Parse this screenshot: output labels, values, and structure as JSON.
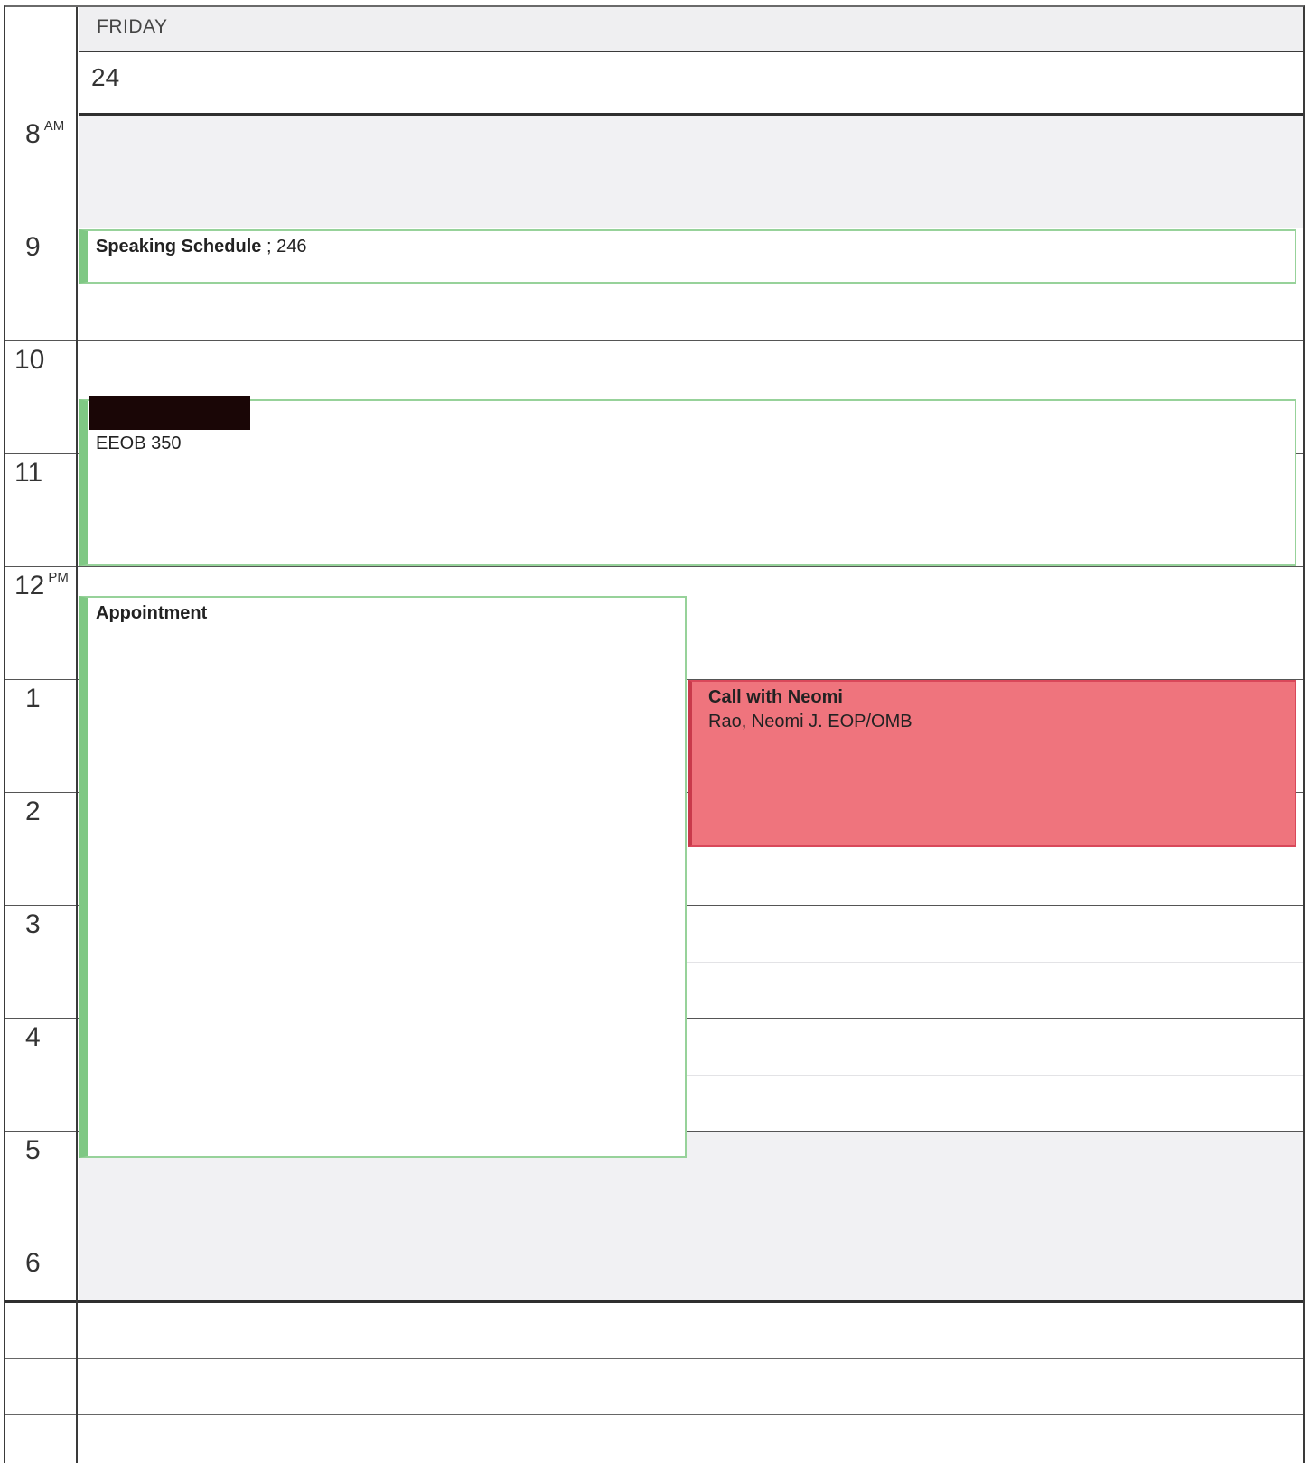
{
  "day": {
    "name": "FRIDAY",
    "date": "24"
  },
  "hours": [
    {
      "label": "8",
      "suffix": "AM"
    },
    {
      "label": "9",
      "suffix": ""
    },
    {
      "label": "10",
      "suffix": ""
    },
    {
      "label": "11",
      "suffix": ""
    },
    {
      "label": "12",
      "suffix": "PM"
    },
    {
      "label": "1",
      "suffix": ""
    },
    {
      "label": "2",
      "suffix": ""
    },
    {
      "label": "3",
      "suffix": ""
    },
    {
      "label": "4",
      "suffix": ""
    },
    {
      "label": "5",
      "suffix": ""
    },
    {
      "label": "6",
      "suffix": ""
    }
  ],
  "events": {
    "speaking": {
      "title": "Speaking Schedule",
      "location": "; 246",
      "color": "#7fc884"
    },
    "redacted": {
      "location": "EEOB 350",
      "color": "#7fc884"
    },
    "appointment": {
      "title": "Appointment",
      "color": "#7fc884"
    },
    "call": {
      "title": "Call with Neomi",
      "attendee": "Rao, Neomi J. EOP/OMB",
      "color": "#ef747d"
    }
  }
}
